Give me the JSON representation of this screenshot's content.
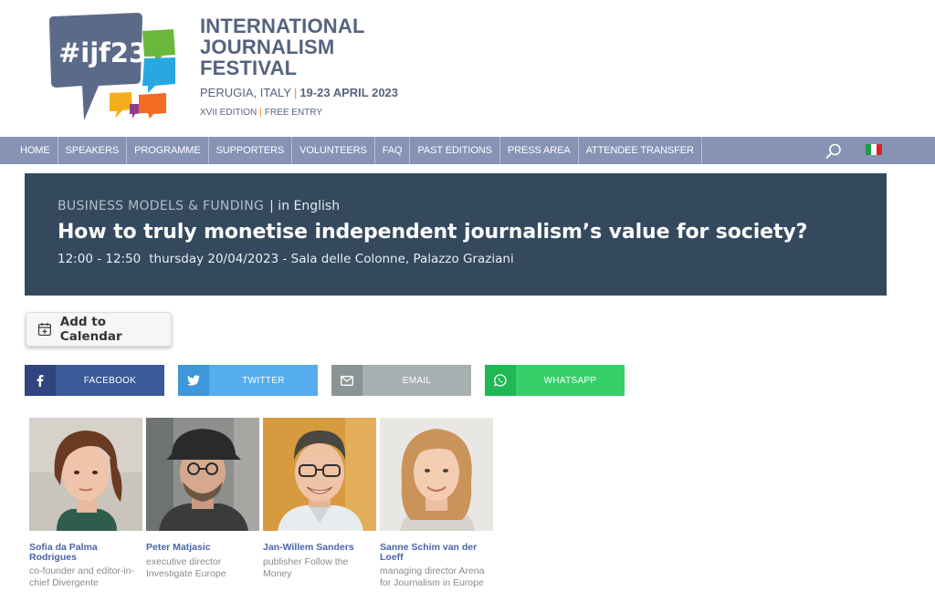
{
  "header": {
    "logo_text": "#ijf23",
    "festival_lines": [
      "INTERNATIONAL",
      "JOURNALISM",
      "FESTIVAL"
    ],
    "location": "PERUGIA, ITALY",
    "dates": "19-23 APRIL 2023",
    "edition": "XVII EDITION",
    "entry": "FREE ENTRY"
  },
  "nav": {
    "items": [
      "HOME",
      "SPEAKERS",
      "PROGRAMME",
      "SUPPORTERS",
      "VOLUNTEERS",
      "FAQ",
      "PAST EDITIONS",
      "PRESS AREA",
      "ATTENDEE TRANSFER"
    ],
    "search_icon": "search-icon",
    "language_flag": "italian-flag-icon"
  },
  "session": {
    "category": "BUSINESS MODELS & FUNDING",
    "language": "| in English",
    "title": "How to truly monetise independent journalism’s value for society?",
    "time": "12:00 - 12:50",
    "when_where": "thursday 20/04/2023 - Sala delle Colonne, Palazzo Graziani"
  },
  "calendar": {
    "label": "Add to Calendar",
    "icon": "calendar-plus-icon"
  },
  "share": {
    "facebook": "FACEBOOK",
    "twitter": "TWITTER",
    "email": "EMAIL",
    "whatsapp": "WHATSAPP"
  },
  "speakers": [
    {
      "name": "Sofia da Palma Rodrigues",
      "role": "co-founder and editor-in-chief Divergente"
    },
    {
      "name": "Peter Matjasic",
      "role": "executive director Investigate Europe"
    },
    {
      "name": "Jan-Willem Sanders",
      "role": "publisher Follow the Money"
    },
    {
      "name": "Sanne Schim van der Loeff",
      "role": "managing director Arena for Journalism in Europe"
    }
  ],
  "colors": {
    "brand": "#55637f",
    "nav": "#8693b4",
    "banner": "#34495e",
    "facebook": "#3b5998",
    "twitter": "#55acee",
    "email": "#a7b0b0",
    "whatsapp": "#35d06a",
    "speaker_name": "#4a64a8"
  }
}
